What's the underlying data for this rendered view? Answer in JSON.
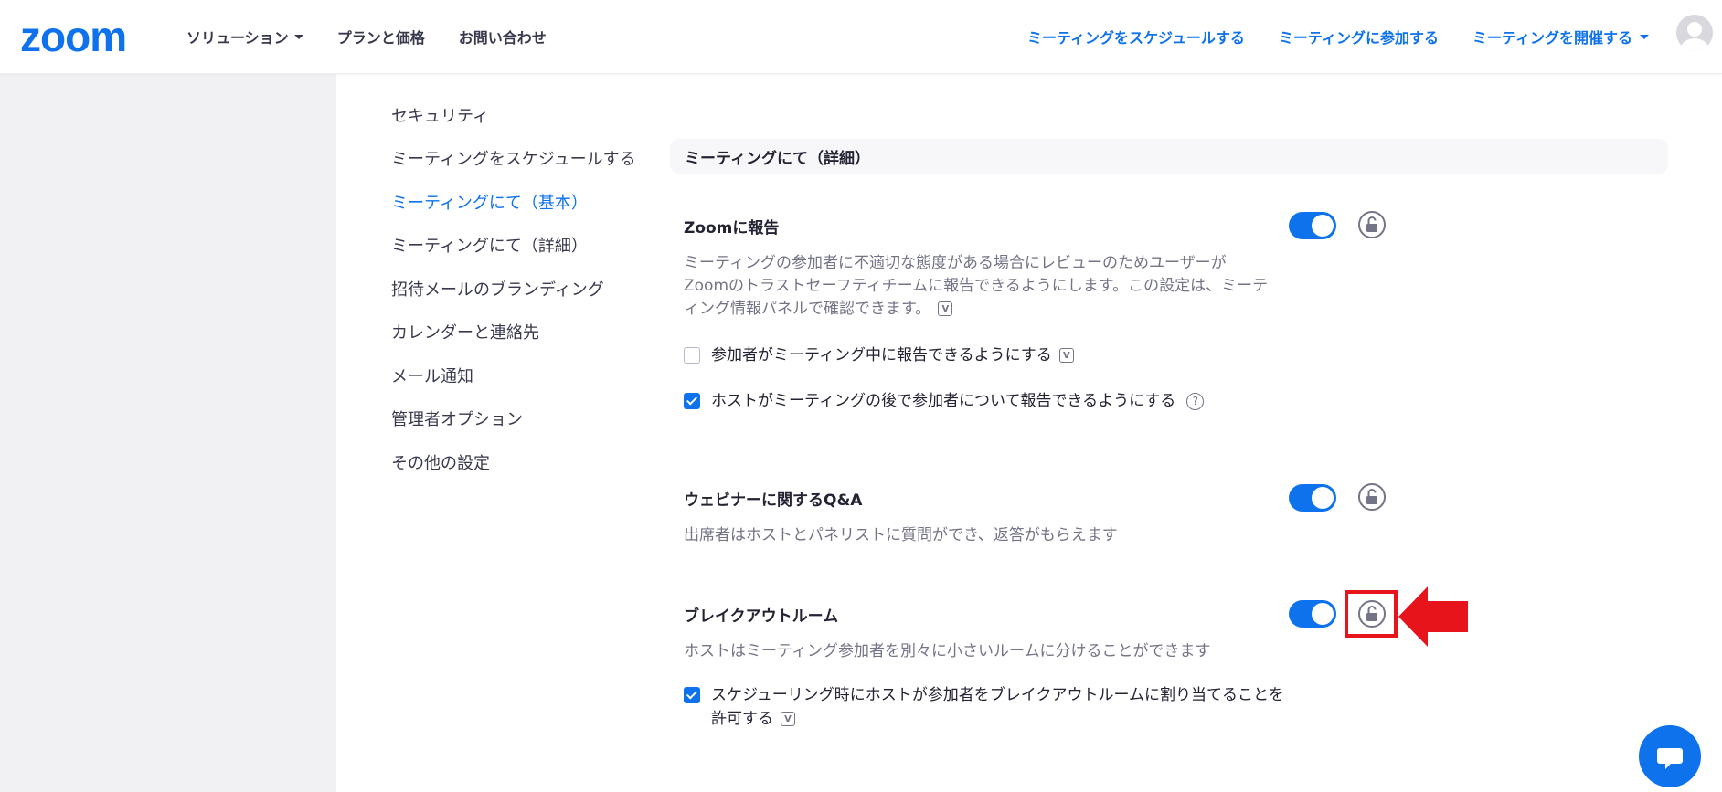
{
  "brand": {
    "logo_text": "zoom",
    "accent": "#0e72ed",
    "highlight": "#e8141b"
  },
  "nav": {
    "left": [
      "ソリューション",
      "プランと価格",
      "お問い合わせ"
    ],
    "right": [
      "ミーティングをスケジュールする",
      "ミーティングに参加する",
      "ミーティングを開催する"
    ],
    "avatar_icon": "user-avatar-icon"
  },
  "sidebar": {
    "items": [
      {
        "label": "セキュリティ"
      },
      {
        "label": "ミーティングをスケジュールする"
      },
      {
        "label": "ミーティングにて（基本）",
        "active": true
      },
      {
        "label": "ミーティングにて（詳細）"
      },
      {
        "label": "招待メールのブランディング"
      },
      {
        "label": "カレンダーと連絡先"
      },
      {
        "label": "メール通知"
      },
      {
        "label": "管理者オプション"
      },
      {
        "label": "その他の設定"
      }
    ]
  },
  "section": {
    "title": "ミーティングにて（詳細）"
  },
  "settings": {
    "report": {
      "title": "Zoomに報告",
      "desc": "ミーティングの参加者に不適切な態度がある場合にレビューのためユーザーがZoomのトラストセーフティチームに報告できるようにします。この設定は、ミーティング情報パネルで確認できます。",
      "enabled": true,
      "options": [
        {
          "label": "参加者がミーティング中に報告できるようにする",
          "checked": false
        },
        {
          "label": "ホストがミーティングの後で参加者について報告できるようにする",
          "checked": true
        }
      ]
    },
    "qa": {
      "title": "ウェビナーに関するQ&A",
      "desc": "出席者はホストとパネリストに質問ができ、返答がもらえます",
      "enabled": true
    },
    "breakout": {
      "title": "ブレイクアウトルーム",
      "desc": "ホストはミーティング参加者を別々に小さいルームに分けることができます",
      "enabled": true,
      "options": [
        {
          "label": "スケジューリング時にホストが参加者をブレイクアウトルームに割り当てることを許可する",
          "checked": true
        }
      ]
    }
  },
  "icons": {
    "v_badge": "V",
    "help": "?"
  }
}
